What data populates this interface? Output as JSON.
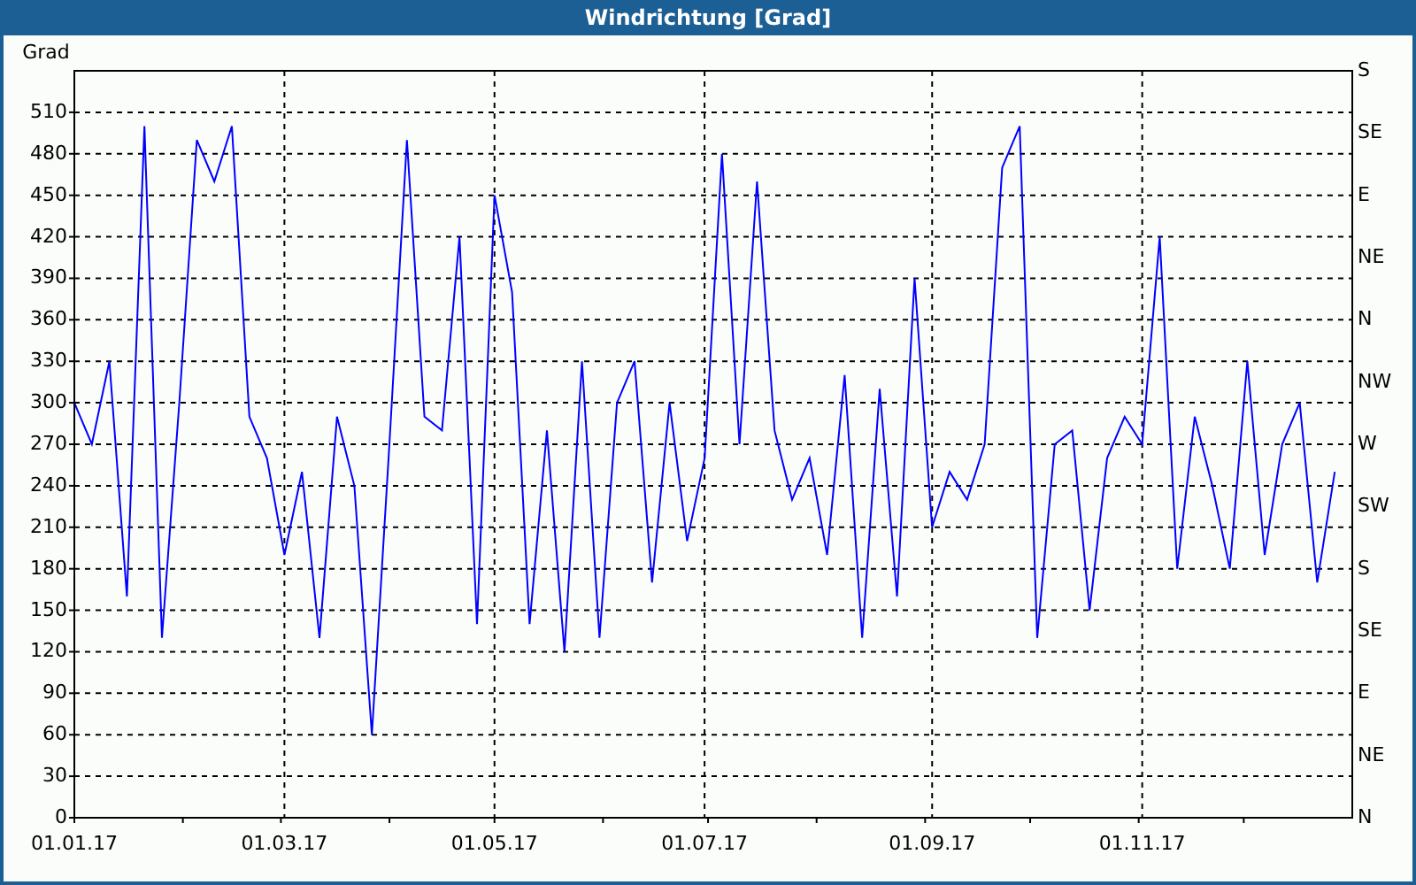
{
  "window": {
    "title": "Windrichtung [Grad]"
  },
  "chart": {
    "right_ticks": [
      "S",
      "SE",
      "E",
      "NE",
      "N",
      "NW",
      "W",
      "SW",
      "S",
      "SE",
      "E",
      "NE",
      "N"
    ],
    "chart_data": {
      "type": "line",
      "ylabel": "Grad",
      "categories": [
        "01.01.17",
        null,
        null,
        null,
        null,
        null,
        null,
        null,
        null,
        null,
        null,
        null,
        "01.03.17",
        null,
        null,
        null,
        null,
        null,
        null,
        null,
        null,
        null,
        null,
        null,
        "01.05.17",
        null,
        null,
        null,
        null,
        null,
        null,
        null,
        null,
        null,
        null,
        null,
        "01.07.17",
        null,
        null,
        null,
        null,
        null,
        null,
        null,
        null,
        null,
        null,
        null,
        null,
        "01.09.17",
        null,
        null,
        null,
        null,
        null,
        null,
        null,
        null,
        null,
        null,
        null,
        "01.11.17",
        null,
        null,
        null,
        null,
        null,
        null,
        null,
        null,
        null,
        null,
        null
      ],
      "series": [
        {
          "color": "#0000ff",
          "values": [
            300,
            270,
            330,
            160,
            500,
            130,
            300,
            490,
            460,
            500,
            290,
            260,
            190,
            250,
            130,
            290,
            240,
            60,
            270,
            490,
            290,
            280,
            420,
            140,
            450,
            380,
            140,
            280,
            120,
            330,
            130,
            300,
            330,
            170,
            300,
            200,
            260,
            480,
            270,
            460,
            280,
            230,
            260,
            190,
            320,
            130,
            310,
            160,
            390,
            210,
            250,
            230,
            270,
            470,
            500,
            130,
            270,
            280,
            150,
            260,
            290,
            270,
            420,
            180,
            290,
            240,
            180,
            330,
            190,
            270,
            300,
            170,
            250
          ]
        }
      ],
      "grid": true,
      "ylim": [
        0,
        540
      ],
      "yticks": [
        510,
        480,
        450,
        420,
        390,
        360,
        330,
        300,
        270,
        240,
        210,
        180,
        150,
        120,
        90,
        60,
        30,
        0
      ]
    }
  }
}
